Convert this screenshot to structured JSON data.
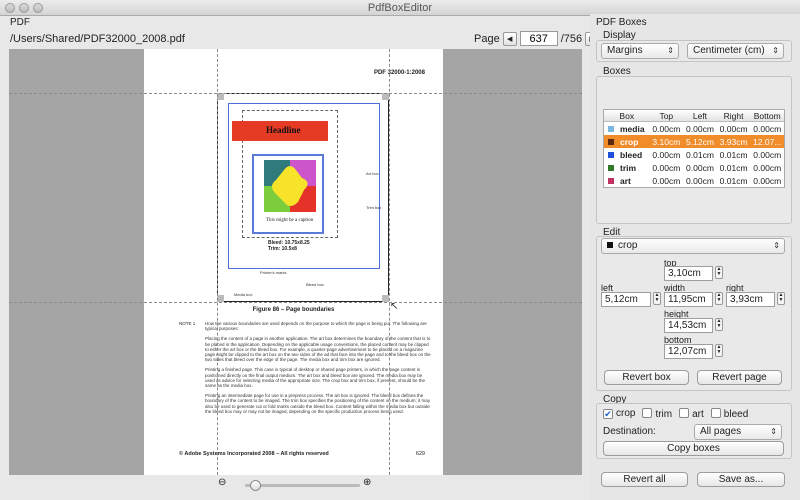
{
  "window": {
    "title": "PdfBoxEditor"
  },
  "pdf": {
    "section_label": "PDF",
    "path": "/Users/Shared/PDF32000_2008.pdf",
    "page_label": "Page",
    "current_page": "637",
    "total_pages": "/756"
  },
  "doc": {
    "header": "PDF 32000-1:2008",
    "headline": "Headline",
    "caption": "This might be a caption",
    "bleed_info": "Bleed: 10.75x8.25",
    "trim_info": "Trim: 10.5x8",
    "art_box": "Art box",
    "trim_box": "Trim box",
    "printers_marks": "Printer's marks",
    "bleed_box": "Bleed box",
    "media_box": "Media box",
    "figure_title": "Figure 86 –  Page boundaries",
    "note_label": "NOTE 1",
    "note_p1": "How the various boundaries are used depends on the purpose to which the page is being put. The following are typical purposes:",
    "note_p2": "Placing the content of a page in another application. The art box determines the boundary of the content that is to be placed in the application. Depending on the applicable usage conventions, the placed content may be clipped to either the art box or the bleed box. For example, a quarter-page advertisement to be placed on a magazine page might be clipped to the art box on the two sides of the ad that face into the page and to the bleed box on the two sides that bleed over the edge of the page. The media box and trim box are ignored.",
    "note_p3": "Printing a finished page. This case is typical of desktop or shared page printers, in which the page content is positioned directly on the final output medium. The art box and bleed box are ignored. The media box may be used as advice for selecting media of the appropriate size. The crop box and trim box, if present, should be the same as the media box.",
    "note_p4": "Printing an intermediate page for use in a prepress process. The art box is ignored. The bleed box defines the boundary of the content to be imaged. The trim box specifies the positioning of the content on the medium; it may also be used to generate cut or fold marks outside the bleed box. Content falling within the media box but outside the bleed box may or may not be imaged, depending on the specific production process being used.",
    "footer": "© Adobe Systems Incorporated 2008 – All rights reserved",
    "page_number": "629"
  },
  "zoom": {
    "level": 0.05
  },
  "panel": {
    "title": "PDF Boxes",
    "display_label": "Display",
    "display_mode": "Margins",
    "unit": "Centimeter (cm)",
    "boxes_label": "Boxes",
    "columns": [
      "Box",
      "Top",
      "Left",
      "Right",
      "Bottom"
    ],
    "rows": [
      {
        "name": "media",
        "color": "#7ab8e0",
        "top": "0.00cm",
        "left": "0.00cm",
        "right": "0.00cm",
        "bottom": "0.00cm"
      },
      {
        "name": "crop",
        "color": "#5a2a10",
        "top": "3.10cm",
        "left": "5.12cm",
        "right": "3.93cm",
        "bottom": "12.07..."
      },
      {
        "name": "bleed",
        "color": "#1f4fd8",
        "top": "0.00cm",
        "left": "0.01cm",
        "right": "0.01cm",
        "bottom": "0.00cm"
      },
      {
        "name": "trim",
        "color": "#2f7a2a",
        "top": "0.00cm",
        "left": "0.00cm",
        "right": "0.01cm",
        "bottom": "0.00cm"
      },
      {
        "name": "art",
        "color": "#c03060",
        "top": "0.00cm",
        "left": "0.00cm",
        "right": "0.01cm",
        "bottom": "0.00cm"
      }
    ],
    "edit_label": "Edit",
    "edit_box": "crop",
    "top_label": "top",
    "top_value": "3,10cm",
    "left_label": "left",
    "left_value": "5,12cm",
    "width_label": "width",
    "width_value": "11,95cm",
    "right_label": "right",
    "right_value": "3,93cm",
    "height_label": "height",
    "height_value": "14,53cm",
    "bottom_label": "bottom",
    "bottom_value": "12,07cm",
    "revert_box": "Revert box",
    "revert_page": "Revert page",
    "copy_label": "Copy",
    "copy_options": [
      {
        "label": "crop",
        "checked": true
      },
      {
        "label": "trim",
        "checked": false
      },
      {
        "label": "art",
        "checked": false
      },
      {
        "label": "bleed",
        "checked": false
      }
    ],
    "destination_label": "Destination:",
    "destination_value": "All pages",
    "copy_boxes": "Copy boxes",
    "revert_all": "Revert all",
    "save_as": "Save as..."
  }
}
